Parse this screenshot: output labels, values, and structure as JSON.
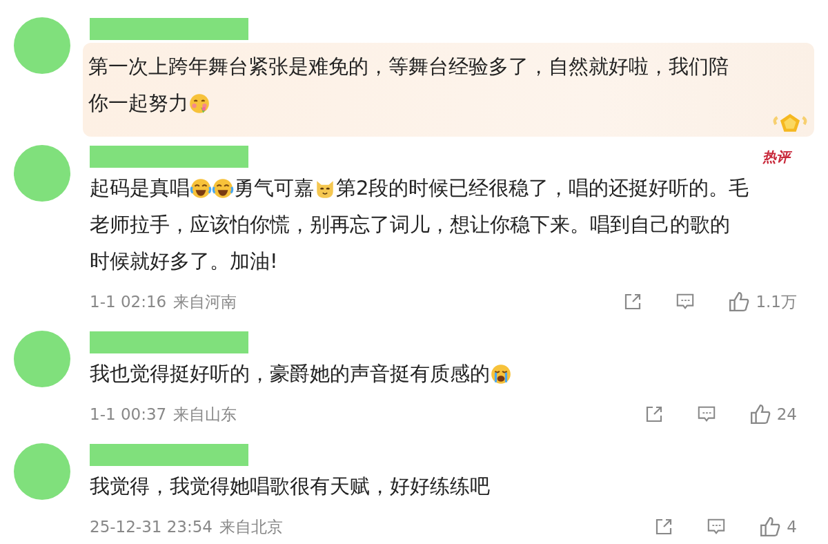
{
  "comments": [
    {
      "featured": true,
      "lines": [
        [
          {
            "kind": "text",
            "text": "第一次上跨年舞台紧张是难免的，等舞台经验多了，自然就好啦，我们陪"
          }
        ],
        [
          {
            "kind": "text",
            "text": "你一起努力"
          },
          {
            "kind": "blush"
          }
        ]
      ]
    },
    {
      "featured": false,
      "tag": "热评",
      "lines": [
        [
          {
            "kind": "text",
            "text": "起码是真唱"
          },
          {
            "kind": "laugh"
          },
          {
            "kind": "laugh"
          },
          {
            "kind": "text",
            "text": "勇气可嘉"
          },
          {
            "kind": "cat"
          },
          {
            "kind": "text",
            "text": "第2段的时候已经很稳了，唱的还挺好听的。毛"
          }
        ],
        [
          {
            "kind": "text",
            "text": "老师拉手，应该怕你慌，别再忘了词儿，想让你稳下来。唱到自己的歌的"
          }
        ],
        [
          {
            "kind": "text",
            "text": "时候就好多了。加油!"
          }
        ]
      ],
      "time": "1-1 02:16",
      "location": "来自河南",
      "likes": "1.1万"
    },
    {
      "featured": false,
      "lines": [
        [
          {
            "kind": "text",
            "text": "我也觉得挺好听的，豪爵她的声音挺有质感的"
          },
          {
            "kind": "cry"
          }
        ]
      ],
      "time": "1-1 00:37",
      "location": "来自山东",
      "likes": "24"
    },
    {
      "featured": false,
      "lines": [
        [
          {
            "kind": "text",
            "text": "我觉得，我觉得她唱歌很有天赋，好好练练吧"
          }
        ]
      ],
      "time": "25-12-31 23:54",
      "location": "来自北京",
      "likes": "4"
    }
  ]
}
